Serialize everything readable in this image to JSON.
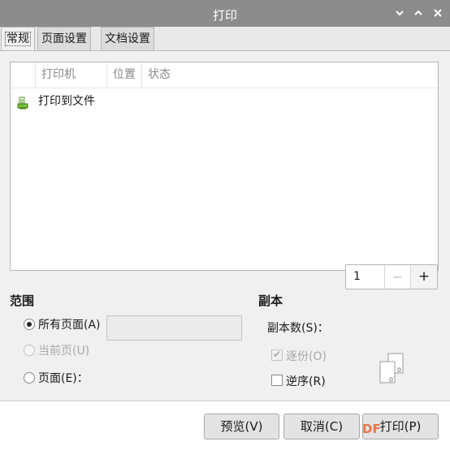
{
  "window": {
    "title": "打印"
  },
  "tabs": [
    {
      "label": "常规"
    },
    {
      "label": "页面设置"
    },
    {
      "label": "文档设置"
    }
  ],
  "printer_list": {
    "columns": [
      "打印机",
      "位置",
      "状态"
    ],
    "rows": [
      {
        "name": "打印到文件",
        "icon": "print-to-file-icon"
      }
    ]
  },
  "range": {
    "heading": "范围",
    "all_pages": "所有页面(A)",
    "current_page": "当前页(U)",
    "pages": "页面(E)："
  },
  "copies": {
    "heading": "副本",
    "count_label": "副本数(S)：",
    "count": "1",
    "minus": "−",
    "plus": "+",
    "collate": "逐份(O)",
    "reverse": "逆序(R)"
  },
  "buttons": {
    "preview": "预览(V)",
    "cancel": "取消(C)",
    "print": "打印(P)"
  },
  "watermark": "DF"
}
